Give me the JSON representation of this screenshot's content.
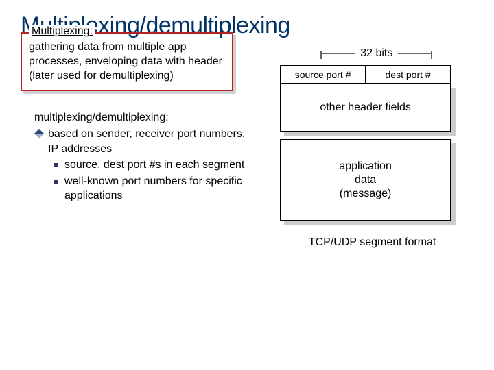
{
  "title": "Multiplexing/demultiplexing",
  "mx": {
    "legend": "Multiplexing:",
    "body": "gathering data from multiple app processes, enveloping data with header (later used for demultiplexing)"
  },
  "list": {
    "heading": "multiplexing/demultiplexing:",
    "item1": "based on sender, receiver port numbers, IP addresses",
    "sub1": "source, dest port #s in each segment",
    "sub2": "well-known port numbers for specific applications"
  },
  "figure": {
    "bits": "32 bits",
    "src_port": "source port #",
    "dst_port": "dest port #",
    "other": "other header fields",
    "data": "application\ndata\n(message)",
    "caption": "TCP/UDP segment format"
  }
}
